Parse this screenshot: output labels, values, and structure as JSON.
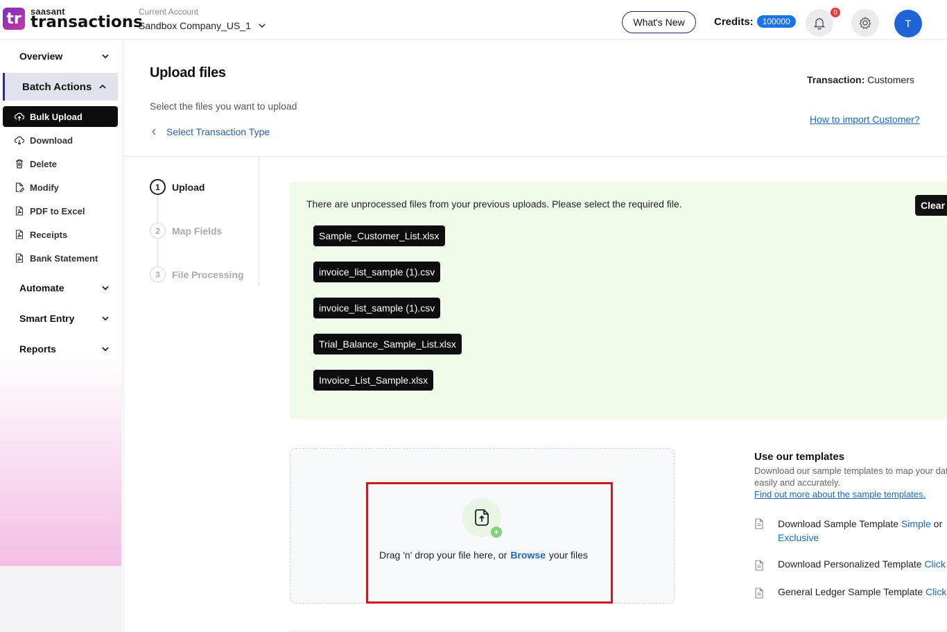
{
  "app": {
    "logo_mark": "tr",
    "logo_small": "saasant",
    "logo_big": "transactions"
  },
  "header": {
    "account_label": "Current Account",
    "account_value": "Sandbox Company_US_1",
    "whats_new": "What's New",
    "credits_label": "Credits:",
    "credits_value": "100000",
    "notification_count": "0",
    "avatar_initial": "T"
  },
  "sidebar": {
    "overview": "Overview",
    "batch_actions": "Batch Actions",
    "items": [
      {
        "label": "Bulk Upload",
        "icon": "upload-cloud-icon"
      },
      {
        "label": "Download",
        "icon": "download-cloud-icon"
      },
      {
        "label": "Delete",
        "icon": "trash-icon"
      },
      {
        "label": "Modify",
        "icon": "edit-file-icon"
      },
      {
        "label": "PDF to Excel",
        "icon": "pdf-icon"
      },
      {
        "label": "Receipts",
        "icon": "pdf-icon"
      },
      {
        "label": "Bank Statement",
        "icon": "pdf-icon"
      }
    ],
    "automate": "Automate",
    "smart_entry": "Smart Entry",
    "reports": "Reports"
  },
  "main": {
    "title": "Upload files",
    "subtitle": "Select the files you want to upload",
    "back_link": "Select Transaction Type",
    "transaction_label": "Transaction:",
    "transaction_value": "Customers",
    "how_to_link": "How to import Customer?"
  },
  "steps": [
    {
      "num": "1",
      "label": "Upload"
    },
    {
      "num": "2",
      "label": "Map Fields"
    },
    {
      "num": "3",
      "label": "File Processing"
    }
  ],
  "unprocessed": {
    "message": "There are unprocessed files from your previous uploads. Please select the required file.",
    "clear": "Clear",
    "files": [
      "Sample_Customer_List.xlsx",
      "invoice_list_sample (1).csv",
      "invoice_list_sample (1).csv",
      "Trial_Balance_Sample_List.xlsx",
      "Invoice_List_Sample.xlsx"
    ]
  },
  "dropzone": {
    "text_before": "Drag 'n' drop your file here, or",
    "browse": "Browse",
    "text_after": "your files",
    "plus": "+"
  },
  "templates": {
    "title": "Use our templates",
    "description": "Download our sample templates to map your data easily and accurately.",
    "link": "Find out more about the sample templates.",
    "row1_text": "Download Sample Template",
    "row1_link1": "Simple",
    "row1_or": "or",
    "row1_link2": "Exclusive",
    "row2_text": "Download Personalized Template",
    "row2_link": "Click Here",
    "row3_text": "General Ledger Sample Template",
    "row3_link": "Click Here"
  }
}
